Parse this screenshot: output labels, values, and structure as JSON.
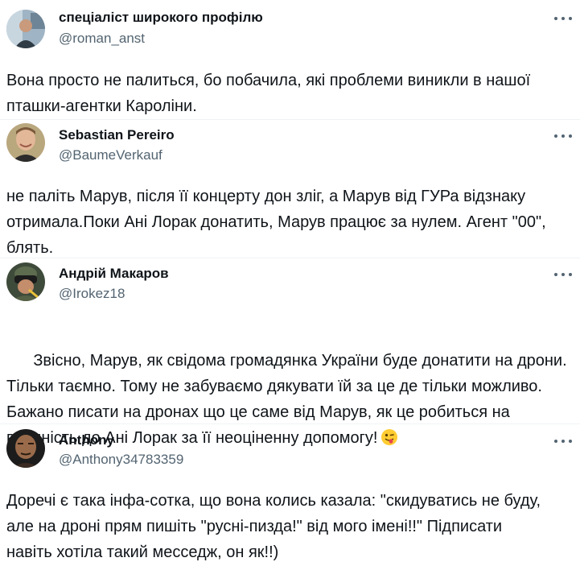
{
  "posts": [
    {
      "display_name": "спеціаліст широкого профілю",
      "handle": "@roman_anst",
      "text": "Вона просто не палиться, бо побачила, які проблеми виникли в нашої\nпташки-агентки Кароліни.",
      "more_icon": "more-options-icon"
    },
    {
      "display_name": "Sebastian Pereiro",
      "handle": "@BaumeVerkauf",
      "text": "не паліть Марув, після її концерту дон зліг, а Марув від ГУРа відзнаку\nотримала.Поки Ані Лорак донатить, Марув працює за нулем. Агент \"00\",\nблять.",
      "more_icon": "more-options-icon"
    },
    {
      "display_name": "Андрій Макаров",
      "handle": "@Irokez18",
      "text": "Звісно, Марув, як свідома громадянка України буде донатити на дрони.\nТільки таємно. Тому не забуваємо дякувати їй за це де тільки можливо.\nБажано писати на дронах що це саме від Марув, як це робиться на\nвдячність до Ані Лорак за її неоціненну допомогу!",
      "emoji": "winking-face-with-tongue",
      "more_icon": "more-options-icon"
    },
    {
      "display_name": "Anthony",
      "handle": "@Anthony34783359",
      "text": "Доречі є така інфа-сотка, що вона колись казала: \"скидуватись не буду,\nале на дроні прям пишіть \"русні-пизда!\" від мого імені!!\" Підписати\nнавіть хотіла такий месседж, он як!!)",
      "more_icon": "more-options-icon"
    }
  ],
  "colors": {
    "text": "#0f1419",
    "secondary": "#536471",
    "divider": "#eff3f4"
  }
}
